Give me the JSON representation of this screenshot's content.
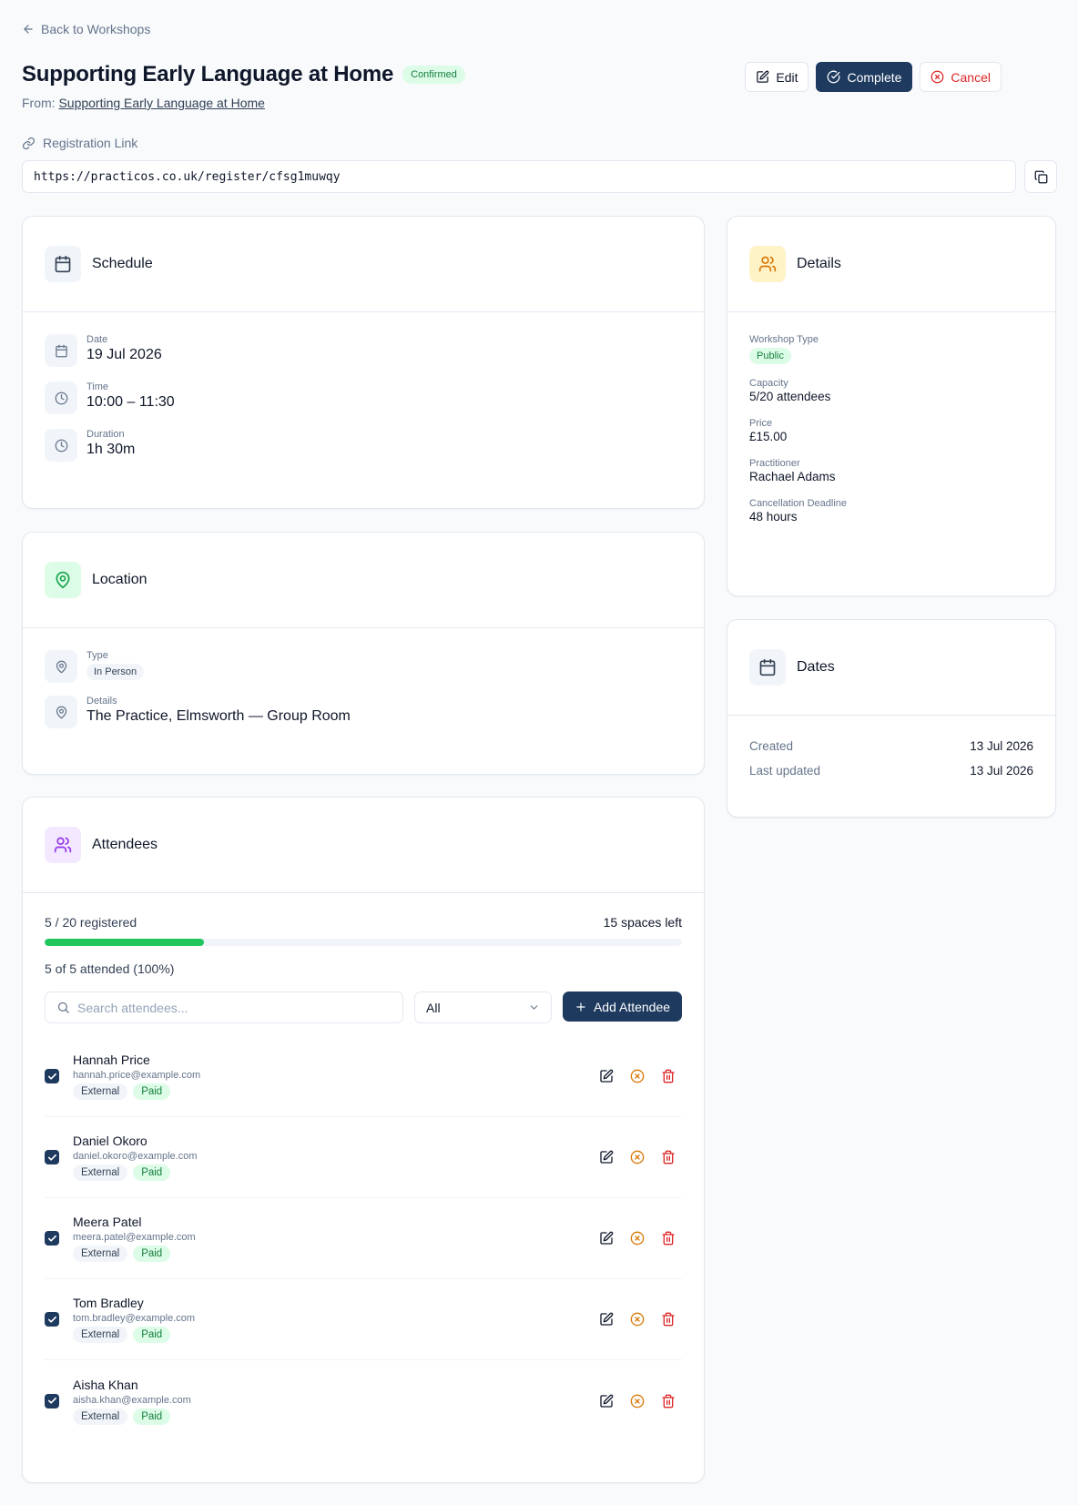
{
  "nav": {
    "back_label": "Back to Workshops"
  },
  "header": {
    "title": "Supporting Early Language at Home",
    "status": "Confirmed",
    "from_prefix": "From:",
    "from_link": "Supporting Early Language at Home",
    "actions": {
      "edit": "Edit",
      "complete": "Complete",
      "cancel": "Cancel"
    }
  },
  "registration": {
    "label": "Registration Link",
    "url": "https://practicos.co.uk/register/cfsg1muwqy"
  },
  "schedule": {
    "title": "Schedule",
    "date_label": "Date",
    "date": "19 Jul 2026",
    "time_label": "Time",
    "time": "10:00 – 11:30",
    "duration_label": "Duration",
    "duration": "1h 30m"
  },
  "location": {
    "title": "Location",
    "type_label": "Type",
    "type": "In Person",
    "details_label": "Details",
    "details": "The Practice, Elmsworth — Group Room"
  },
  "details": {
    "title": "Details",
    "workshop_type_label": "Workshop Type",
    "workshop_type": "Public",
    "capacity_label": "Capacity",
    "capacity": "5/20 attendees",
    "price_label": "Price",
    "price": "£15.00",
    "practitioner_label": "Practitioner",
    "practitioner": "Rachael Adams",
    "deadline_label": "Cancellation Deadline",
    "deadline": "48 hours"
  },
  "dates": {
    "title": "Dates",
    "created_label": "Created",
    "created": "13 Jul 2026",
    "updated_label": "Last updated",
    "updated": "13 Jul 2026"
  },
  "attendees": {
    "title": "Attendees",
    "registered_text": "5 / 20 registered",
    "spaces_left": "15 spaces left",
    "fill_fraction": 0.25,
    "attended_text": "5 of 5 attended (100%)",
    "search_placeholder": "Search attendees...",
    "filter_value": "All",
    "add_label": "Add Attendee",
    "list": [
      {
        "name": "Hannah Price",
        "email": "hannah.price@example.com",
        "tag1": "External",
        "tag2": "Paid"
      },
      {
        "name": "Daniel Okoro",
        "email": "daniel.okoro@example.com",
        "tag1": "External",
        "tag2": "Paid"
      },
      {
        "name": "Meera Patel",
        "email": "meera.patel@example.com",
        "tag1": "External",
        "tag2": "Paid"
      },
      {
        "name": "Tom Bradley",
        "email": "tom.bradley@example.com",
        "tag1": "External",
        "tag2": "Paid"
      },
      {
        "name": "Aisha Khan",
        "email": "aisha.khan@example.com",
        "tag1": "External",
        "tag2": "Paid"
      }
    ]
  },
  "colors": {
    "primary": "#1e3a5f",
    "success": "#22c55e",
    "danger": "#dc2626",
    "warning": "#d97706"
  }
}
